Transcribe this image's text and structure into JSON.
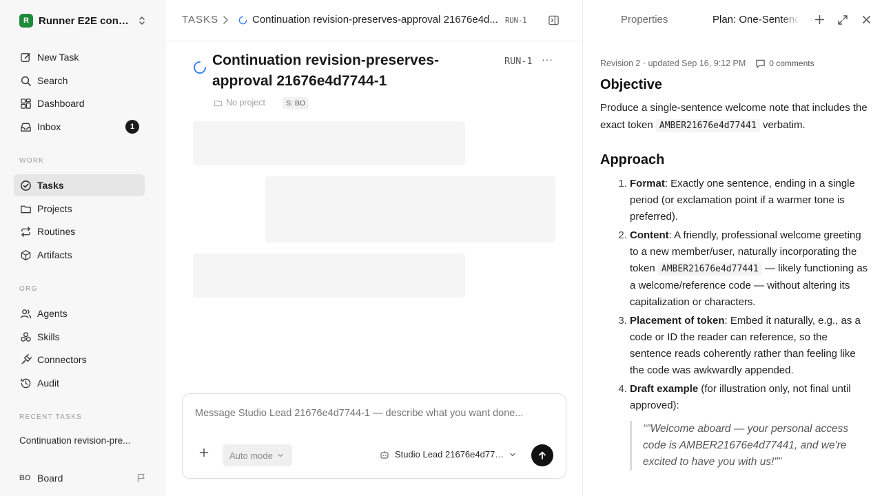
{
  "sidebar": {
    "workspace": {
      "logo": "R",
      "name": "Runner E2E conti..."
    },
    "nav_top": [
      {
        "label": "New Task",
        "icon": "edit-icon"
      },
      {
        "label": "Search",
        "icon": "search-icon"
      },
      {
        "label": "Dashboard",
        "icon": "dashboard-icon"
      },
      {
        "label": "Inbox",
        "icon": "inbox-icon",
        "badge": "1"
      }
    ],
    "work_label": "WORK",
    "nav_work": [
      {
        "label": "Tasks",
        "icon": "check-circle-icon",
        "active": true
      },
      {
        "label": "Projects",
        "icon": "folder-icon"
      },
      {
        "label": "Routines",
        "icon": "repeat-icon"
      },
      {
        "label": "Artifacts",
        "icon": "cube-icon"
      }
    ],
    "org_label": "ORG",
    "nav_org": [
      {
        "label": "Agents",
        "icon": "users-icon"
      },
      {
        "label": "Skills",
        "icon": "skills-icon"
      },
      {
        "label": "Connectors",
        "icon": "plug-icon"
      },
      {
        "label": "Audit",
        "icon": "history-icon"
      }
    ],
    "recent_label": "RECENT TASKS",
    "recent_tasks": [
      "Continuation revision-pre..."
    ],
    "footer": {
      "initials": "BO",
      "label": "Board"
    }
  },
  "center": {
    "breadcrumb": {
      "root": "TASKS",
      "title": "Continuation revision-preserves-approval 21676e4d...",
      "id": "RUN-1"
    },
    "task": {
      "title": "Continuation revision-preserves-approval 21676e4d7744-1",
      "id": "RUN-1",
      "project": "No project",
      "chip": "S: BO"
    },
    "composer": {
      "placeholder": "Message Studio Lead 21676e4d7744-1 — describe what you want done...",
      "mode": "Auto mode",
      "agent": "Studio Lead 21676e4d774..."
    }
  },
  "right_panel": {
    "tabs": {
      "properties": "Properties",
      "plan": "Plan: One-Sentence"
    },
    "revision": "Revision 2 · updated Sep 16, 9:12 PM",
    "comments": "0 comments",
    "objective": {
      "heading": "Objective",
      "text_before": "Produce a single-sentence welcome note that includes the exact token",
      "token": "AMBER21676e4d77441",
      "text_after": "verbatim."
    },
    "approach": {
      "heading": "Approach",
      "steps": [
        {
          "label": "Format",
          "text": ": Exactly one sentence, ending in a single period (or exclamation point if a warmer tone is preferred)."
        },
        {
          "label": "Content",
          "text_before": ": A friendly, professional welcome greeting to a new member/user, naturally incorporating the token",
          "token": "AMBER21676e4d77441",
          "text_after": "— likely functioning as a welcome/reference code — without altering its capitalization or characters."
        },
        {
          "label": "Placement of token",
          "text": ": Embed it naturally, e.g., as a code or ID the reader can reference, so the sentence reads coherently rather than feeling like the code was awkwardly appended."
        },
        {
          "label": "Draft example",
          "text": " (for illustration only, not final until approved):"
        }
      ],
      "quote": "“\"Welcome aboard — your personal access code is AMBER21676e4d77441, and we're excited to have you with us!\"”"
    }
  }
}
